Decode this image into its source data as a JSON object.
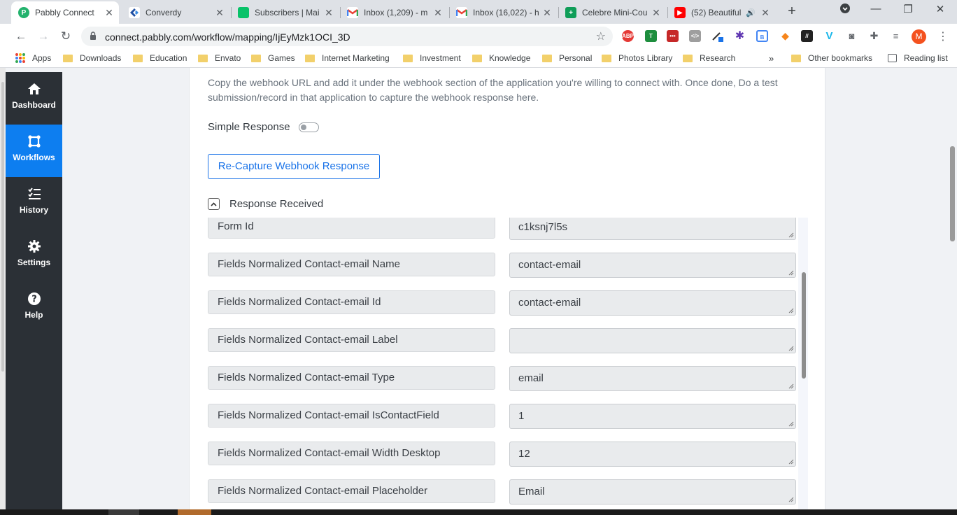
{
  "browser": {
    "tabs": [
      {
        "title": "Pabbly Connect",
        "icon": "pabbly-icon",
        "active": true
      },
      {
        "title": "Converdy",
        "icon": "converdy-icon"
      },
      {
        "title": "Subscribers | Mai",
        "icon": "mailerlite-icon"
      },
      {
        "title": "Inbox (1,209) - m",
        "icon": "gmail-icon"
      },
      {
        "title": "Inbox (16,022) - h",
        "icon": "gmail-icon"
      },
      {
        "title": "Celebre Mini-Cou",
        "icon": "sheets-icon"
      },
      {
        "title": "(52) Beautiful",
        "icon": "youtube-icon"
      }
    ],
    "url": "connect.pabbly.com/workflow/mapping/IjEyMzk1OCI_3D",
    "avatar_letter": "M",
    "bookmarks": [
      {
        "label": "Apps",
        "type": "apps"
      },
      {
        "label": "Downloads"
      },
      {
        "label": "Education"
      },
      {
        "label": "Envato"
      },
      {
        "label": "Games"
      },
      {
        "label": "Internet Marketing"
      },
      {
        "label": "Investment"
      },
      {
        "label": "Knowledge"
      },
      {
        "label": "Personal"
      },
      {
        "label": "Photos Library"
      },
      {
        "label": "Research"
      }
    ],
    "other_bookmarks": "Other bookmarks",
    "reading_list": "Reading list"
  },
  "sidebar": {
    "items": [
      {
        "label": "Dashboard",
        "icon": "home-icon"
      },
      {
        "label": "Workflows",
        "icon": "workflow-icon",
        "active": true
      },
      {
        "label": "History",
        "icon": "list-icon"
      },
      {
        "label": "Settings",
        "icon": "gear-icon"
      },
      {
        "label": "Help",
        "icon": "help-icon"
      }
    ]
  },
  "main": {
    "description": "Copy the webhook URL and add it under the webhook section of the application you're willing to connect with. Once done, Do a test submission/record in that application to capture the webhook response here.",
    "simple_response_label": "Simple Response",
    "simple_response_on": false,
    "recapture_label": "Re-Capture Webhook Response",
    "response_received_label": "Response Received",
    "fields": [
      {
        "key": "Form Id",
        "value": "c1ksnj7l5s"
      },
      {
        "key": "Fields Normalized Contact-email Name",
        "value": "contact-email"
      },
      {
        "key": "Fields Normalized Contact-email Id",
        "value": "contact-email"
      },
      {
        "key": "Fields Normalized Contact-email Label",
        "value": ""
      },
      {
        "key": "Fields Normalized Contact-email Type",
        "value": "email"
      },
      {
        "key": "Fields Normalized Contact-email IsContactField",
        "value": "1"
      },
      {
        "key": "Fields Normalized Contact-email Width Desktop",
        "value": "12"
      },
      {
        "key": "Fields Normalized Contact-email Placeholder",
        "value": "Email"
      }
    ]
  },
  "colors": {
    "sidebar_bg": "#2b3036",
    "sidebar_active": "#0d7ef0",
    "accent": "#1a73e8"
  }
}
